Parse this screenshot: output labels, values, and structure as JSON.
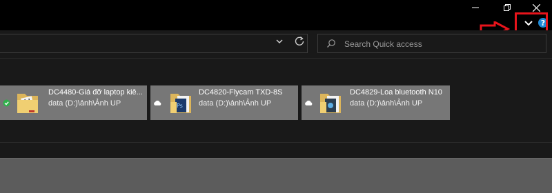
{
  "window": {
    "controls": [
      "minimize",
      "restore",
      "close"
    ]
  },
  "toolbar": {
    "search_placeholder": "Search Quick access"
  },
  "quick_access": {
    "items": [
      {
        "name": "DC4480-Giá đỡ laptop kiê...",
        "path": "data (D:)\\ảnh\\Ảnh UP",
        "status": "synced"
      },
      {
        "name": "DC4820-Flycam TXD-8S",
        "path": "data (D:)\\ảnh\\Ảnh UP",
        "status": "cloud"
      },
      {
        "name": "DC4829-Loa bluetooth N10",
        "path": "data (D:)\\ảnh\\Ảnh UP",
        "status": "cloud"
      }
    ]
  },
  "colors": {
    "annotation": "#e8141b",
    "help_badge": "#1e8ad6",
    "tile_bg": "#777777"
  }
}
